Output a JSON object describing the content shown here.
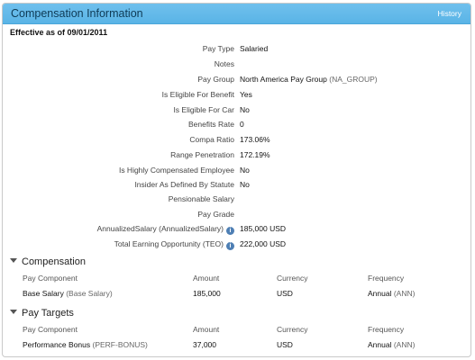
{
  "header": {
    "title": "Compensation Information",
    "history_link": "History"
  },
  "effective_label": "Effective as of 09/01/2011",
  "fields": [
    {
      "label": "Pay Type",
      "value": "Salaried"
    },
    {
      "label": "Notes",
      "value": ""
    },
    {
      "label": "Pay Group",
      "value": "North America Pay Group",
      "value_sub": "(NA_GROUP)"
    },
    {
      "label": "Is Eligible For Benefit",
      "value": "Yes"
    },
    {
      "label": "Is Eligible For Car",
      "value": "No"
    },
    {
      "label": "Benefits Rate",
      "value": "0"
    },
    {
      "label": "Compa Ratio",
      "value": "173.06%"
    },
    {
      "label": "Range Penetration",
      "value": "172.19%"
    },
    {
      "label": "Is Highly Compensated Employee",
      "value": "No"
    },
    {
      "label": "Insider As Defined By Statute",
      "value": "No"
    },
    {
      "label": "Pensionable Salary",
      "value": ""
    },
    {
      "label": "Pay Grade",
      "value": ""
    },
    {
      "label": "AnnualizedSalary",
      "label_sub": "(AnnualizedSalary)",
      "value": "185,000 USD",
      "info_icon": true
    },
    {
      "label": "Total Earning Opportunity",
      "label_sub": "(TEO)",
      "value": "222,000 USD",
      "info_icon": true
    }
  ],
  "compensation": {
    "title": "Compensation",
    "headers": [
      "Pay Component",
      "Amount",
      "Currency",
      "Frequency"
    ],
    "rows": [
      {
        "component": "Base Salary",
        "component_sub": "(Base Salary)",
        "amount": "185,000",
        "currency": "USD",
        "frequency": "Annual",
        "frequency_sub": "(ANN)"
      }
    ]
  },
  "pay_targets": {
    "title": "Pay Targets",
    "headers": [
      "Pay Component",
      "Amount",
      "Currency",
      "Frequency"
    ],
    "rows": [
      {
        "component": "Performance Bonus",
        "component_sub": "(PERF-BONUS)",
        "amount": "37,000",
        "currency": "USD",
        "frequency": "Annual",
        "frequency_sub": "(ANN)"
      }
    ]
  },
  "icons": {
    "collapse": "triangle-down-icon",
    "info": "info-circle-icon"
  },
  "colors": {
    "header_bg": "#5ab4e6",
    "header_text": "#0e3a55",
    "info_icon": "#4e7fb4"
  }
}
